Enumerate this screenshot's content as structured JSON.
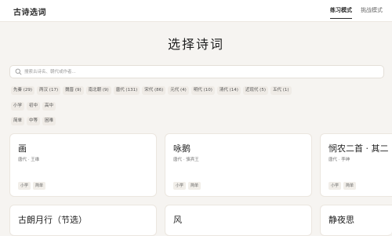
{
  "app": {
    "logo": "古诗选词"
  },
  "nav": {
    "practice": "练习模式",
    "challenge": "挑战模式"
  },
  "page_title": "选择诗词",
  "search": {
    "placeholder": "搜索古诗名、朝代或作者...",
    "value": ""
  },
  "filters": {
    "dynasties": [
      "先秦 (29)",
      "两汉 (17)",
      "魏晋 (9)",
      "南北朝 (9)",
      "唐代 (131)",
      "宋代 (86)",
      "元代 (4)",
      "明代 (10)",
      "清代 (14)",
      "近现代 (5)",
      "五代 (1)"
    ],
    "grades": [
      "小学",
      "初中",
      "高中"
    ],
    "difficulty": [
      "简单",
      "中等",
      "困难"
    ]
  },
  "cards": [
    {
      "title": "画",
      "meta": "唐代 · 王维",
      "tags": [
        "小学",
        "简单"
      ]
    },
    {
      "title": "咏鹅",
      "meta": "唐代 · 骆宾王",
      "tags": [
        "小学",
        "简单"
      ]
    },
    {
      "title": "悯农二首 · 其二",
      "meta": "唐代 · 李绅",
      "tags": [
        "小学",
        "简单"
      ]
    },
    {
      "title": "古朗月行（节选）",
      "meta": "",
      "tags": []
    },
    {
      "title": "风",
      "meta": "",
      "tags": []
    },
    {
      "title": "静夜思",
      "meta": "",
      "tags": []
    }
  ]
}
